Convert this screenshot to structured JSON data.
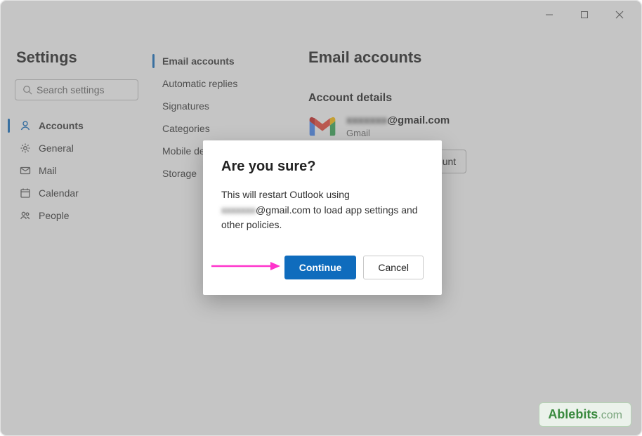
{
  "window": {
    "title": "Settings"
  },
  "search": {
    "placeholder": "Search settings"
  },
  "nav": {
    "items": [
      {
        "label": "Accounts",
        "active": true
      },
      {
        "label": "General"
      },
      {
        "label": "Mail"
      },
      {
        "label": "Calendar"
      },
      {
        "label": "People"
      }
    ]
  },
  "subnav": {
    "items": [
      {
        "label": "Email accounts",
        "active": true
      },
      {
        "label": "Automatic replies"
      },
      {
        "label": "Signatures"
      },
      {
        "label": "Categories"
      },
      {
        "label": "Mobile devices"
      },
      {
        "label": "Storage"
      }
    ]
  },
  "panel": {
    "title": "Email accounts",
    "section_title": "Account details",
    "account": {
      "email_hidden": "xxxxxxx",
      "email_domain": "@gmail.com",
      "provider": "Gmail"
    },
    "primary_button": "Set as primary account"
  },
  "dialog": {
    "title": "Are you sure?",
    "body_pre": "This will restart Outlook using ",
    "body_hidden": "xxxxxxx",
    "body_post": "@gmail.com to load app settings and other policies.",
    "continue": "Continue",
    "cancel": "Cancel"
  },
  "watermark": {
    "brand": "Ablebits",
    "suffix": ".com"
  }
}
